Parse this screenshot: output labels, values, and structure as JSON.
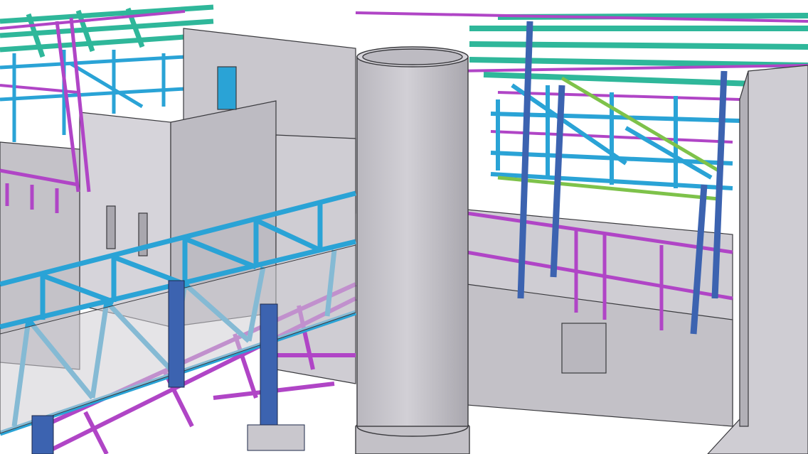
{
  "scene": {
    "kind": "3D steel and concrete structure model render",
    "colors": {
      "background": "#ffffff",
      "concrete": "#c9c7cd",
      "concrete_light": "#d6d4da",
      "concrete_dark": "#a9a7ae",
      "edge": "#3a3a3e",
      "steel_cyan": "#2aa3d6",
      "steel_magenta": "#b045c6",
      "steel_teal": "#2fb79a",
      "steel_blue": "#3c63b0",
      "steel_green": "#7ec24a"
    }
  }
}
